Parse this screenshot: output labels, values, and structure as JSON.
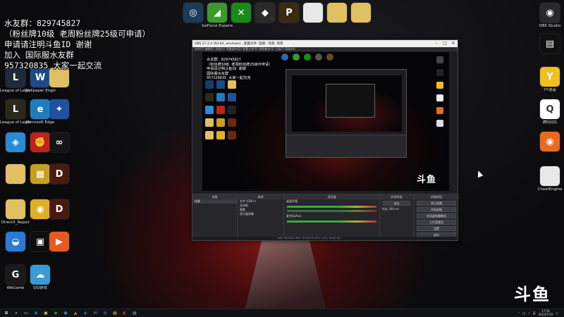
{
  "overlay": {
    "lines": [
      "水友群：829745827",
      "（粉丝牌10级 老周粉丝牌25级可申请）",
      "申请请注明斗鱼ID 谢谢",
      "加入 国际服水友群",
      "957320835 大家一起交流"
    ]
  },
  "desktop_left": [
    {
      "name": "lol-icon",
      "label": "League of Legends",
      "color": "#1f2a3a",
      "glyph": "L"
    },
    {
      "name": "wallpaper-icon",
      "label": "Wallpaper Engine",
      "color": "#1a4a8a",
      "glyph": "W"
    },
    {
      "name": "folder-icon",
      "label": "",
      "color": "#e0c060",
      "glyph": ""
    },
    {
      "name": "lol-pbe-icon",
      "label": "League of Legends PBE",
      "color": "#2a2a1a",
      "glyph": "L"
    },
    {
      "name": "edge-icon",
      "label": "Microsoft Edge",
      "color": "#1f7dbf",
      "glyph": "e"
    },
    {
      "name": "app-icon",
      "label": "",
      "color": "#2050a0",
      "glyph": "✦"
    },
    {
      "name": "tool-icon",
      "label": "",
      "color": "#2a8ad8",
      "glyph": "◈"
    },
    {
      "name": "fist-icon",
      "label": "",
      "color": "#c02020",
      "glyph": "✊"
    },
    {
      "name": "dark-app-icon",
      "label": "",
      "color": "#151515",
      "glyph": "∞"
    },
    {
      "name": "folder-icon",
      "label": "",
      "color": "#e0c060",
      "glyph": ""
    },
    {
      "name": "grid-app-icon",
      "label": "",
      "color": "#c8a020",
      "glyph": "▦"
    },
    {
      "name": "d2-icon",
      "label": "",
      "color": "#4a1a10",
      "glyph": "D"
    },
    {
      "name": "folder-icon",
      "label": "DirectX_Repair",
      "color": "#e0c060",
      "glyph": ""
    },
    {
      "name": "gold-app-icon",
      "label": "",
      "color": "#e0b020",
      "glyph": "◉"
    },
    {
      "name": "d2r-icon",
      "label": "",
      "color": "#4a1a10",
      "glyph": "D"
    },
    {
      "name": "qq-bird-icon",
      "label": "",
      "color": "#2a7ad8",
      "glyph": "◒"
    },
    {
      "name": "black-app-icon",
      "label": "",
      "color": "#0e0e0e",
      "glyph": "▣"
    },
    {
      "name": "orange-app-icon",
      "label": "",
      "color": "#e85a20",
      "glyph": "▶"
    },
    {
      "name": "wegame-icon",
      "label": "WeGame",
      "color": "#1a1a1a",
      "glyph": "G"
    },
    {
      "name": "qq-game-icon",
      "label": "QQ游戏",
      "color": "#3a9ad8",
      "glyph": "☁"
    }
  ],
  "desktop_top": [
    {
      "name": "app-icon",
      "label": "",
      "color": "#1c3a5a",
      "glyph": "◎"
    },
    {
      "name": "geforce-icon",
      "label": "GeForce Experience",
      "color": "#3a9a2a",
      "glyph": "◢"
    },
    {
      "name": "xbox-icon",
      "label": "",
      "color": "#1a8a1a",
      "glyph": "✕"
    },
    {
      "name": "game-app-icon",
      "label": "",
      "color": "#2a2a2a",
      "glyph": "◆"
    },
    {
      "name": "poe-icon",
      "label": "",
      "color": "#3a2a10",
      "glyph": "P"
    },
    {
      "name": "file-icon",
      "label": "",
      "color": "#e8e8e8",
      "glyph": ""
    },
    {
      "name": "folder-icon",
      "label": "",
      "color": "#e0c060",
      "glyph": ""
    },
    {
      "name": "folder-icon",
      "label": "",
      "color": "#e0c060",
      "glyph": ""
    }
  ],
  "desktop_right": [
    {
      "name": "obs-studio-icon",
      "label": "OBS Studio",
      "color": "#2a2a2e",
      "glyph": "◉"
    },
    {
      "name": "terminal-icon",
      "label": "",
      "color": "#101010",
      "glyph": "▤"
    },
    {
      "name": "yy-icon",
      "label": "YY语音",
      "color": "#f0c020",
      "glyph": "Y"
    },
    {
      "name": "qq-icon",
      "label": "腾讯QQ",
      "color": "#ffffff",
      "glyph": "Q"
    },
    {
      "name": "app-icon",
      "label": "",
      "color": "#e86a20",
      "glyph": "◉"
    },
    {
      "name": "file-icon",
      "label": "CheatEngine",
      "color": "#e8e8e8",
      "glyph": ""
    }
  ],
  "obs": {
    "title": "OBS 27.2.4 (64-bit, windows) - 配置文件: 直播 - 场景: 场景",
    "menu": "文件(F)  编辑(E)  视图(V)  停靠部件(D)  配置文件(P)  场景集合(S)  工具(T)  帮助(H)",
    "docks": {
      "scenes": "场景",
      "sources": "来源",
      "mixer": "混音器",
      "transitions": "转场特效",
      "controls": "控制按钮"
    },
    "scene_items": [
      "场景"
    ],
    "source_items": [
      "文字 (GDI+)",
      "文本框",
      "图像",
      "显示器采集"
    ],
    "mixer_items": [
      "桌面音频",
      "麦克风/Aux"
    ],
    "transition_items": [
      "淡出",
      "时长 300 ms"
    ],
    "control_buttons": [
      "停止直播",
      "开始录制",
      "启动虚拟摄像机",
      "工作室模式",
      "设置",
      "退出"
    ],
    "status": "LIVE: 00:00:00  REC: 00:00:00  CPU: 1.2%, 60.00 fps",
    "mini_overlay_lines": [
      "水友群：829745827",
      "（粉丝牌10级 老周粉丝牌25级可申请）",
      "申请请注明斗鱼ID 谢谢",
      "国际服水友群",
      "957320835 大家一起交流"
    ],
    "mini_logo": "斗鱼"
  },
  "watermark": "斗鱼",
  "taskbar": {
    "items": [
      "⊞",
      "⌕",
      "▭",
      "◉",
      "▣",
      "◆",
      "●",
      "▲",
      "◈",
      "✉",
      "◎",
      "▦",
      "◐",
      "▤"
    ],
    "tray_lang": "英",
    "time": "17:16",
    "date": "2023/7/19"
  }
}
